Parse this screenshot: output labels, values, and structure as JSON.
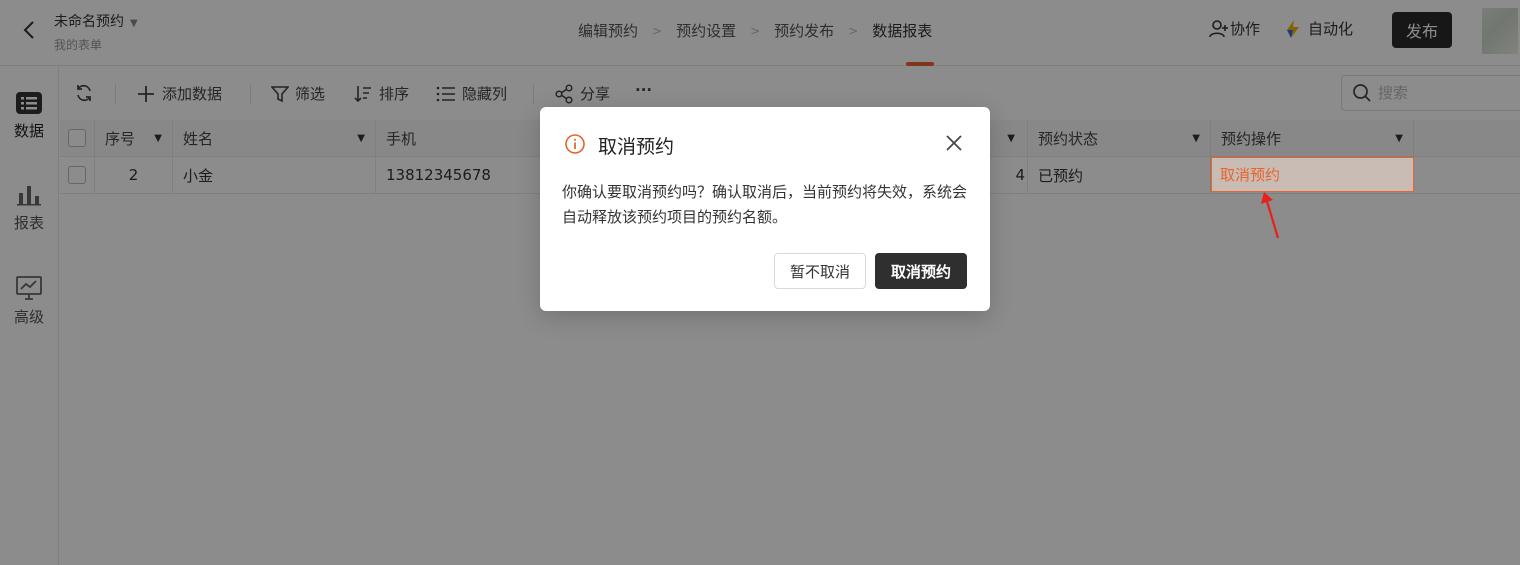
{
  "header": {
    "form_title": "未命名预约",
    "form_subtitle": "我的表单",
    "steps": [
      "编辑预约",
      "预约设置",
      "预约发布",
      "数据报表"
    ],
    "active_step": "数据报表",
    "collab_label": "协作",
    "automation_label": "自动化",
    "publish_label": "发布"
  },
  "sidebar": {
    "items": [
      {
        "label": "数据",
        "icon": "list-icon"
      },
      {
        "label": "报表",
        "icon": "bar-chart-icon"
      },
      {
        "label": "高级",
        "icon": "monitor-chart-icon"
      }
    ]
  },
  "toolbar": {
    "refresh_icon": "refresh-icon",
    "add_label": "添加数据",
    "filter_label": "筛选",
    "sort_label": "排序",
    "hide_cols_label": "隐藏列",
    "share_label": "分享",
    "more_label": "···",
    "search_placeholder": "搜索"
  },
  "table": {
    "headers": [
      "序号",
      "姓名",
      "手机",
      "预约状态",
      "预约操作"
    ],
    "rows": [
      {
        "index": "2",
        "name": "小金",
        "phone": "13812345678",
        "partial": "4",
        "status": "已预约",
        "action": "取消预约"
      }
    ]
  },
  "dialog": {
    "title": "取消预约",
    "body": "你确认要取消预约吗？确认取消后，当前预约将失效，系统会自动释放该预约项目的预约名额。",
    "keep_label": "暂不取消",
    "confirm_label": "取消预约"
  },
  "colors": {
    "accent": "#e8642c",
    "dark_button": "#2f2f2f",
    "overlay": "rgba(0,0,0,0.45)"
  }
}
